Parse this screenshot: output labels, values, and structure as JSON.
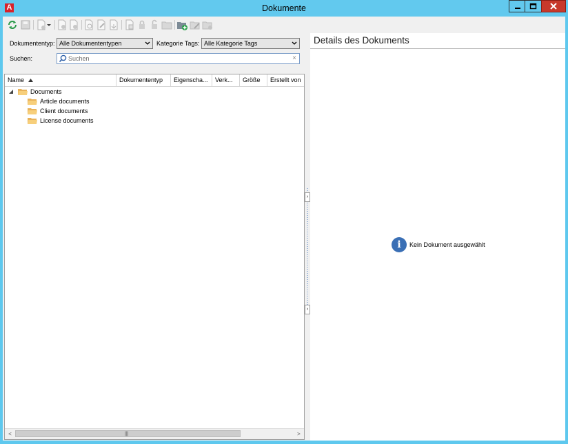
{
  "window": {
    "title": "Dokumente",
    "app_logo": "A"
  },
  "toolbar": {
    "icons": [
      "refresh-icon",
      "save-icon",
      "new-document-icon",
      "document-dropdown-icon",
      "document-action-icon",
      "document-action-icon",
      "document-open-icon",
      "document-edit-icon",
      "document-export-icon",
      "document-copy-icon",
      "lock-icon",
      "unlock-icon",
      "folder-icon",
      "new-folder-icon",
      "edit-folder-icon",
      "folder-settings-icon"
    ]
  },
  "filters": {
    "doc_type_label": "Dokumententyp:",
    "doc_type_value": "Alle Dokumententypen",
    "tags_label": "Kategorie Tags:",
    "tags_value": "Alle Kategorie Tags",
    "search_label": "Suchen:",
    "search_placeholder": "Suchen"
  },
  "grid": {
    "columns": [
      "Name",
      "Dokumententyp",
      "Eigenscha...",
      "Verk...",
      "Größe",
      "Erstellt von"
    ],
    "sort_column": "Name",
    "sort_direction": "ascending",
    "tree": {
      "root": "Documents",
      "children": [
        "Article documents",
        "Client documents",
        "License documents"
      ]
    },
    "hscroll_grip": "|||"
  },
  "details": {
    "title": "Details des Dokuments",
    "empty_message": "Kein Dokument ausgewählt",
    "info_glyph": "i"
  },
  "colors": {
    "titlebar": "#62c9ee",
    "close_button": "#c7392b",
    "folder": "#f2c46d",
    "info": "#3a6fb5",
    "logo": "#d9222a"
  }
}
